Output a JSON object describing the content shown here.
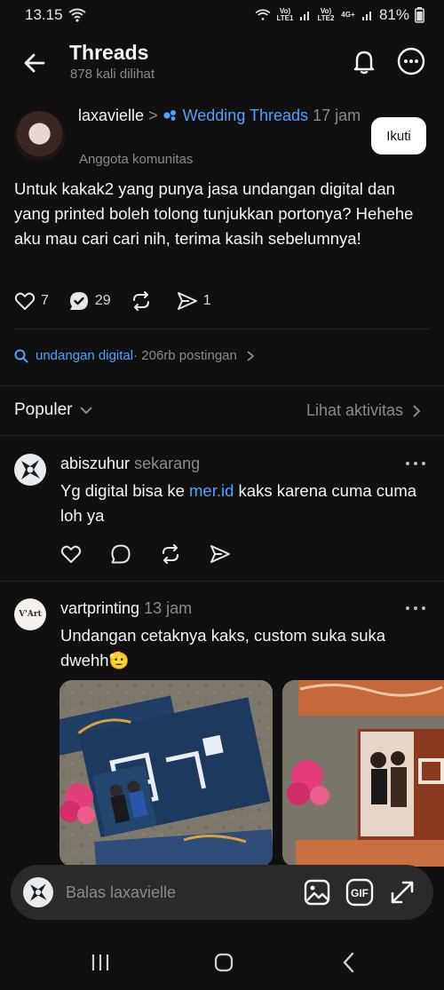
{
  "status": {
    "time": "13.15",
    "battery": "81%",
    "sim1": "Vo) LTE1",
    "sim2": "Vo) LTE2",
    "net": "4G+"
  },
  "header": {
    "title": "Threads",
    "views": "878 kali dilihat"
  },
  "post": {
    "username": "laxavielle",
    "separator": ">",
    "community": "Wedding Threads",
    "time": "17 jam",
    "membership": "Anggota komunitas",
    "follow_label": "Ikuti",
    "body": "Untuk kakak2 yang punya jasa undangan digital dan yang printed boleh tolong tunjukkan portonya? Hehehe aku mau cari cari nih, terima kasih sebelumnya!",
    "likes": "7",
    "replies": "29",
    "shares": "1"
  },
  "topic": {
    "tag": "undangan digital",
    "count": " · 206rb postingan"
  },
  "sort": {
    "label": "Populer",
    "activity": "Lihat aktivitas"
  },
  "replies": [
    {
      "username": "abiszuhur",
      "time": "sekarang",
      "text_before": "Yg digital bisa ke ",
      "link": "mer.id",
      "text_after": " kaks karena cuma cuma loh ya"
    },
    {
      "username": "vartprinting",
      "time": "13 jam",
      "avatar_text": "V'Art",
      "text": "Undangan cetaknya kaks, custom suka suka dwehh🫡"
    }
  ],
  "reply_bar": {
    "placeholder": "Balas laxavielle"
  },
  "colors": {
    "background": "#101010",
    "link": "#4da3ff",
    "muted": "#8a8a8a"
  }
}
